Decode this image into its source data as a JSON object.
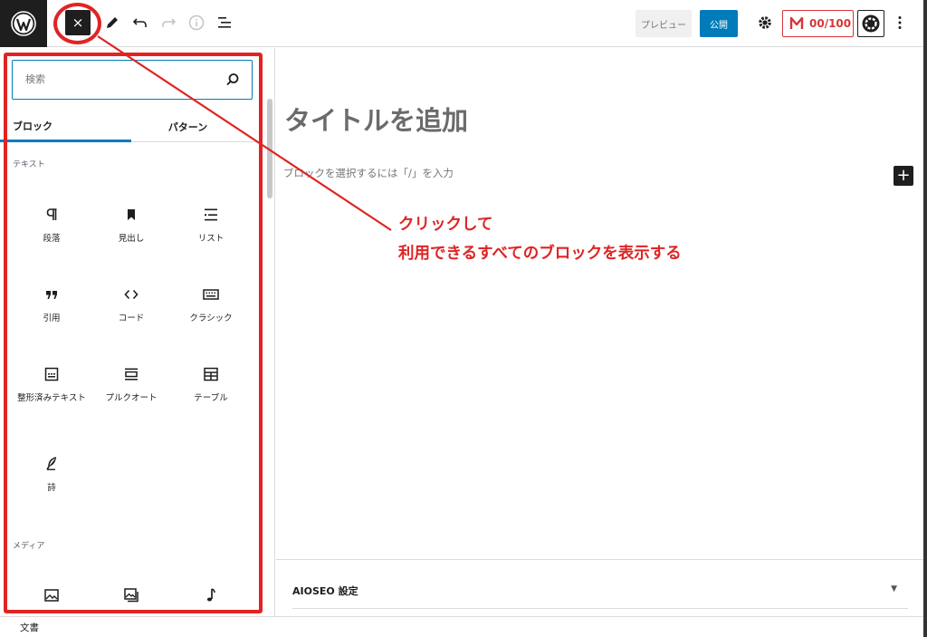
{
  "toolbar": {
    "close_label": "×",
    "preview_label": "プレビュー",
    "publish_label": "公開",
    "score_label": "00/100"
  },
  "inserter": {
    "search_placeholder": "検索",
    "tabs": [
      {
        "label": "ブロック",
        "active": true
      },
      {
        "label": "パターン",
        "active": false
      }
    ],
    "categories": {
      "text": "テキスト",
      "media": "メディア"
    },
    "text_blocks": [
      {
        "label": "段落",
        "icon": "paragraph-icon"
      },
      {
        "label": "見出し",
        "icon": "heading-icon"
      },
      {
        "label": "リスト",
        "icon": "list-icon"
      },
      {
        "label": "引用",
        "icon": "quote-icon"
      },
      {
        "label": "コード",
        "icon": "code-icon"
      },
      {
        "label": "クラシック",
        "icon": "keyboard-icon"
      },
      {
        "label": "整形済みテキスト",
        "icon": "preformatted-icon"
      },
      {
        "label": "プルクオート",
        "icon": "pullquote-icon"
      },
      {
        "label": "テーブル",
        "icon": "table-icon"
      },
      {
        "label": "詩",
        "icon": "feather-icon"
      }
    ],
    "media_blocks": [
      {
        "icon": "image-icon"
      },
      {
        "icon": "gallery-icon"
      },
      {
        "icon": "audio-icon"
      }
    ]
  },
  "editor": {
    "title_placeholder": "タイトルを追加",
    "block_prompt": "ブロックを選択するには「/」を入力"
  },
  "meta": {
    "aioseo_title": "AIOSEO 設定"
  },
  "footer": {
    "label": "文書"
  },
  "annotation": {
    "line1": "クリックして",
    "line2": "利用できるすべてのブロックを表示する"
  },
  "colors": {
    "accent": "#007cba",
    "annotation": "#e02424",
    "dark": "#1e1e1e"
  }
}
